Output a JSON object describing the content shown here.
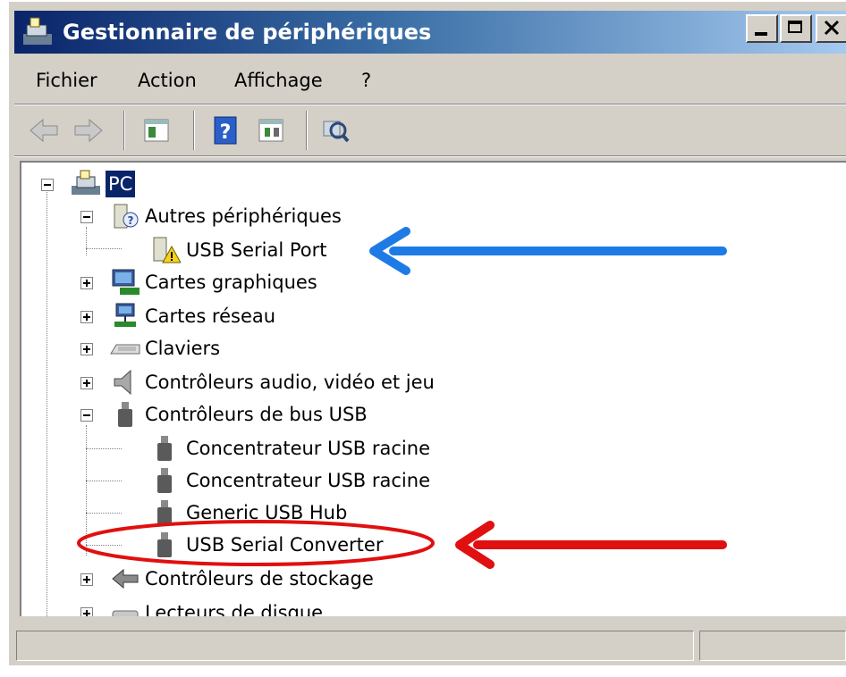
{
  "window": {
    "title": "Gestionnaire de périphériques"
  },
  "menu": {
    "items": [
      "Fichier",
      "Action",
      "Affichage",
      "?"
    ]
  },
  "toolbar": {
    "buttons": [
      "back-icon",
      "forward-icon",
      "show-hide-console-tree-icon",
      "help-icon",
      "properties-icon",
      "scan-hardware-icon"
    ]
  },
  "tree": {
    "root": "PC",
    "nodes": [
      {
        "label": "Autres périphériques",
        "expanded": true,
        "children": [
          "USB Serial Port"
        ]
      },
      {
        "label": "Cartes graphiques",
        "expanded": false
      },
      {
        "label": "Cartes réseau",
        "expanded": false
      },
      {
        "label": "Claviers",
        "expanded": false
      },
      {
        "label": "Contrôleurs audio, vidéo et jeu",
        "expanded": false
      },
      {
        "label": "Contrôleurs de bus USB",
        "expanded": true,
        "children": [
          "Concentrateur USB racine",
          "Concentrateur USB racine",
          "Generic USB Hub",
          "USB Serial Converter"
        ]
      },
      {
        "label": "Contrôleurs de stockage",
        "expanded": false
      },
      {
        "label": "Lecteurs de disque",
        "expanded": false
      }
    ]
  },
  "annotations": {
    "blue_arrow_color": "#1e7be6",
    "red_arrow_color": "#e01010",
    "ellipse_color": "#e01010"
  },
  "statusbar": {
    "panes": [
      "",
      ""
    ]
  }
}
